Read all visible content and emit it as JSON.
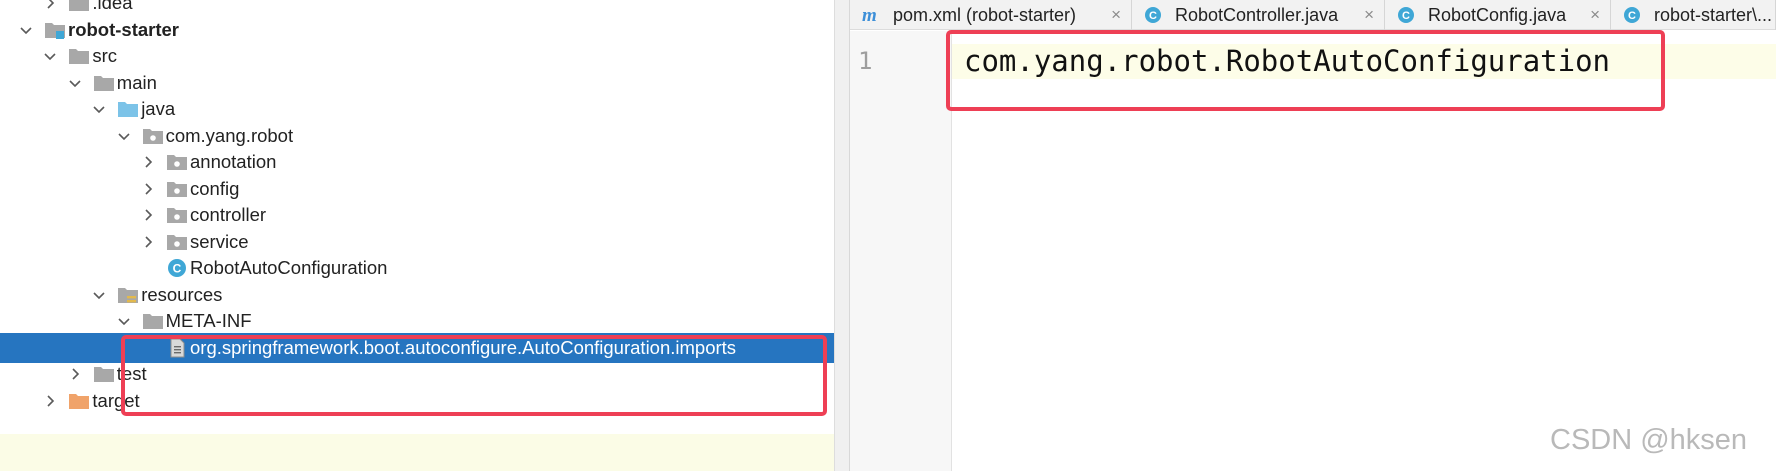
{
  "project_tree": {
    "items": [
      {
        "label": ".idea",
        "depth": 1,
        "expanded": false,
        "icon": "folder-gray-icon",
        "bold": false
      },
      {
        "label": "robot-starter",
        "depth": 0,
        "expanded": true,
        "icon": "module-folder-icon",
        "bold": true
      },
      {
        "label": "src",
        "depth": 1,
        "expanded": true,
        "icon": "folder-gray-icon",
        "bold": false
      },
      {
        "label": "main",
        "depth": 2,
        "expanded": true,
        "icon": "folder-gray-icon",
        "bold": false
      },
      {
        "label": "java",
        "depth": 3,
        "expanded": true,
        "icon": "source-folder-icon",
        "bold": false
      },
      {
        "label": "com.yang.robot",
        "depth": 4,
        "expanded": true,
        "icon": "package-icon",
        "bold": false
      },
      {
        "label": "annotation",
        "depth": 5,
        "expanded": false,
        "icon": "package-icon",
        "bold": false
      },
      {
        "label": "config",
        "depth": 5,
        "expanded": false,
        "icon": "package-icon",
        "bold": false
      },
      {
        "label": "controller",
        "depth": 5,
        "expanded": false,
        "icon": "package-icon",
        "bold": false
      },
      {
        "label": "service",
        "depth": 5,
        "expanded": false,
        "icon": "package-icon",
        "bold": false
      },
      {
        "label": "RobotAutoConfiguration",
        "depth": 5,
        "expanded": null,
        "icon": "java-class-icon",
        "bold": false
      },
      {
        "label": "resources",
        "depth": 3,
        "expanded": true,
        "icon": "resources-folder-icon",
        "bold": false
      },
      {
        "label": "META-INF",
        "depth": 4,
        "expanded": true,
        "icon": "folder-gray-icon",
        "bold": false
      },
      {
        "label": "org.springframework.boot.autoconfigure.AutoConfiguration.imports",
        "depth": 5,
        "expanded": null,
        "icon": "text-file-icon",
        "bold": false,
        "selected": true
      },
      {
        "label": "test",
        "depth": 2,
        "expanded": false,
        "icon": "folder-gray-icon",
        "bold": false
      },
      {
        "label": "target",
        "depth": 1,
        "expanded": false,
        "icon": "folder-orange-icon",
        "bold": false
      }
    ]
  },
  "editor": {
    "tabs": [
      {
        "label": "pom.xml (robot-starter)",
        "icon": "maven-icon"
      },
      {
        "label": "RobotController.java",
        "icon": "java-class-icon"
      },
      {
        "label": "RobotConfig.java",
        "icon": "java-class-icon"
      },
      {
        "label": "robot-starter\\...",
        "icon": "java-class-icon"
      }
    ],
    "close_glyph": "×",
    "line_number": "1",
    "code": "com.yang.robot.RobotAutoConfiguration"
  },
  "watermark": "CSDN @hksen",
  "colors": {
    "selection": "#2675c0",
    "highlight_box": "#ee3f55",
    "current_line": "#fdfde8",
    "class_icon": "#3fa7d6"
  }
}
